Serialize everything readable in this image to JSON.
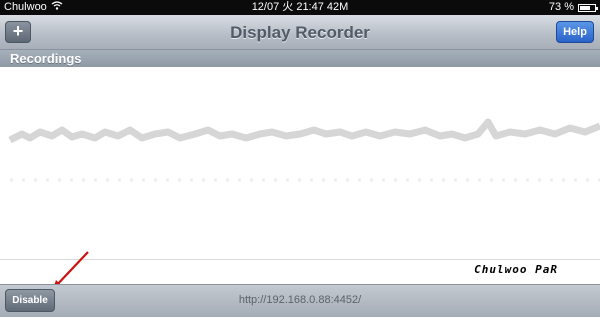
{
  "status_bar": {
    "carrier": "Chulwoo",
    "time": "12/07 火 21:47 42M",
    "battery_percent": "73 %",
    "battery_level": 0.73
  },
  "navbar": {
    "title": "Display Recorder",
    "add_label": "+",
    "help_label": "Help"
  },
  "section": {
    "header": "Recordings"
  },
  "annotation": {
    "signature": "Chulwoo PaR"
  },
  "toolbar": {
    "disable_label": "Disable",
    "url": "http://192.168.0.88:4452/"
  },
  "colors": {
    "arrow": "#cc1111",
    "help_button": "#2a63c8"
  }
}
